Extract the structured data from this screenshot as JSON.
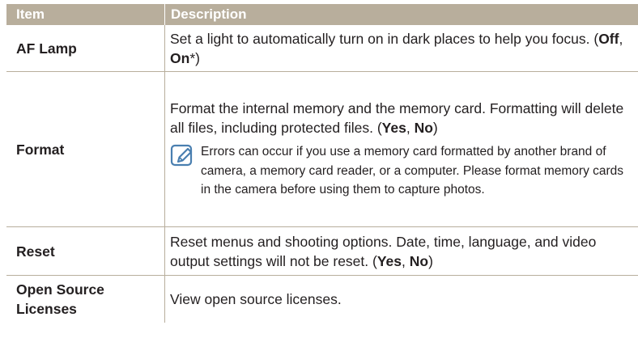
{
  "table": {
    "headers": {
      "item": "Item",
      "description": "Description"
    },
    "af_lamp": {
      "item": "AF Lamp",
      "desc": "Set a light to automatically turn on in dark places to help you focus. (",
      "opt1": "Off",
      "sep": ", ",
      "opt2": "On",
      "tail": "*)"
    },
    "format": {
      "item": "Format",
      "desc": "Format the internal memory and the memory card. Formatting will delete all files, including protected files. (",
      "opt1": "Yes",
      "sep": ", ",
      "opt2": "No",
      "tail": ")",
      "note": "Errors can occur if you use a memory card formatted by another brand of camera, a memory card reader, or a computer. Please format memory cards in the camera before using them to capture photos."
    },
    "reset": {
      "item": "Reset",
      "desc": "Reset menus and shooting options. Date, time, language, and video output settings will not be reset. (",
      "opt1": "Yes",
      "sep": ", ",
      "opt2": "No",
      "tail": ")"
    },
    "open_source": {
      "item": "Open Source Licenses",
      "desc": "View open source licenses."
    }
  },
  "colors": {
    "header_bg": "#b8ae9c",
    "note_icon": "#4a7fb0"
  },
  "icons": {
    "note": "note-pencil-icon"
  }
}
